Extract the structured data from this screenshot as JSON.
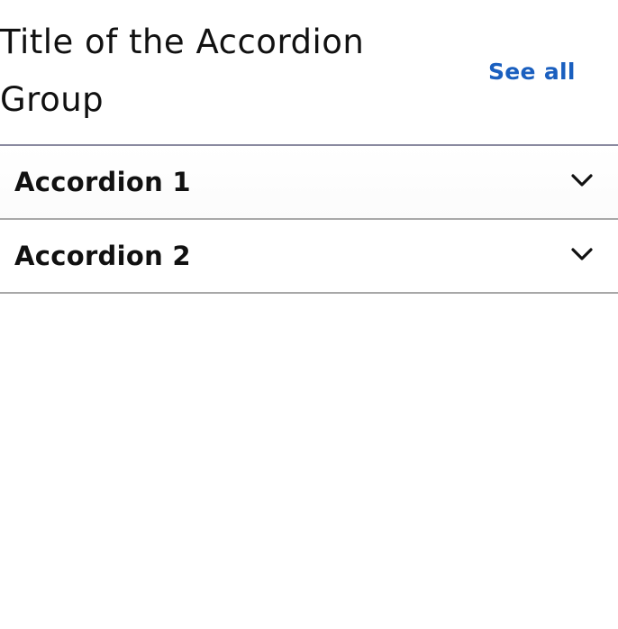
{
  "accordion_group": {
    "title": "Title of the Accordion Group",
    "see_all_label": "See all",
    "items": [
      {
        "label": "Accordion 1",
        "icon": "chevron-down-icon",
        "expanded": false
      },
      {
        "label": "Accordion 2",
        "icon": "chevron-down-icon",
        "expanded": false
      }
    ]
  },
  "colors": {
    "link": "#1a5fbf",
    "text": "#111111",
    "divider": "#a8a8a8"
  }
}
